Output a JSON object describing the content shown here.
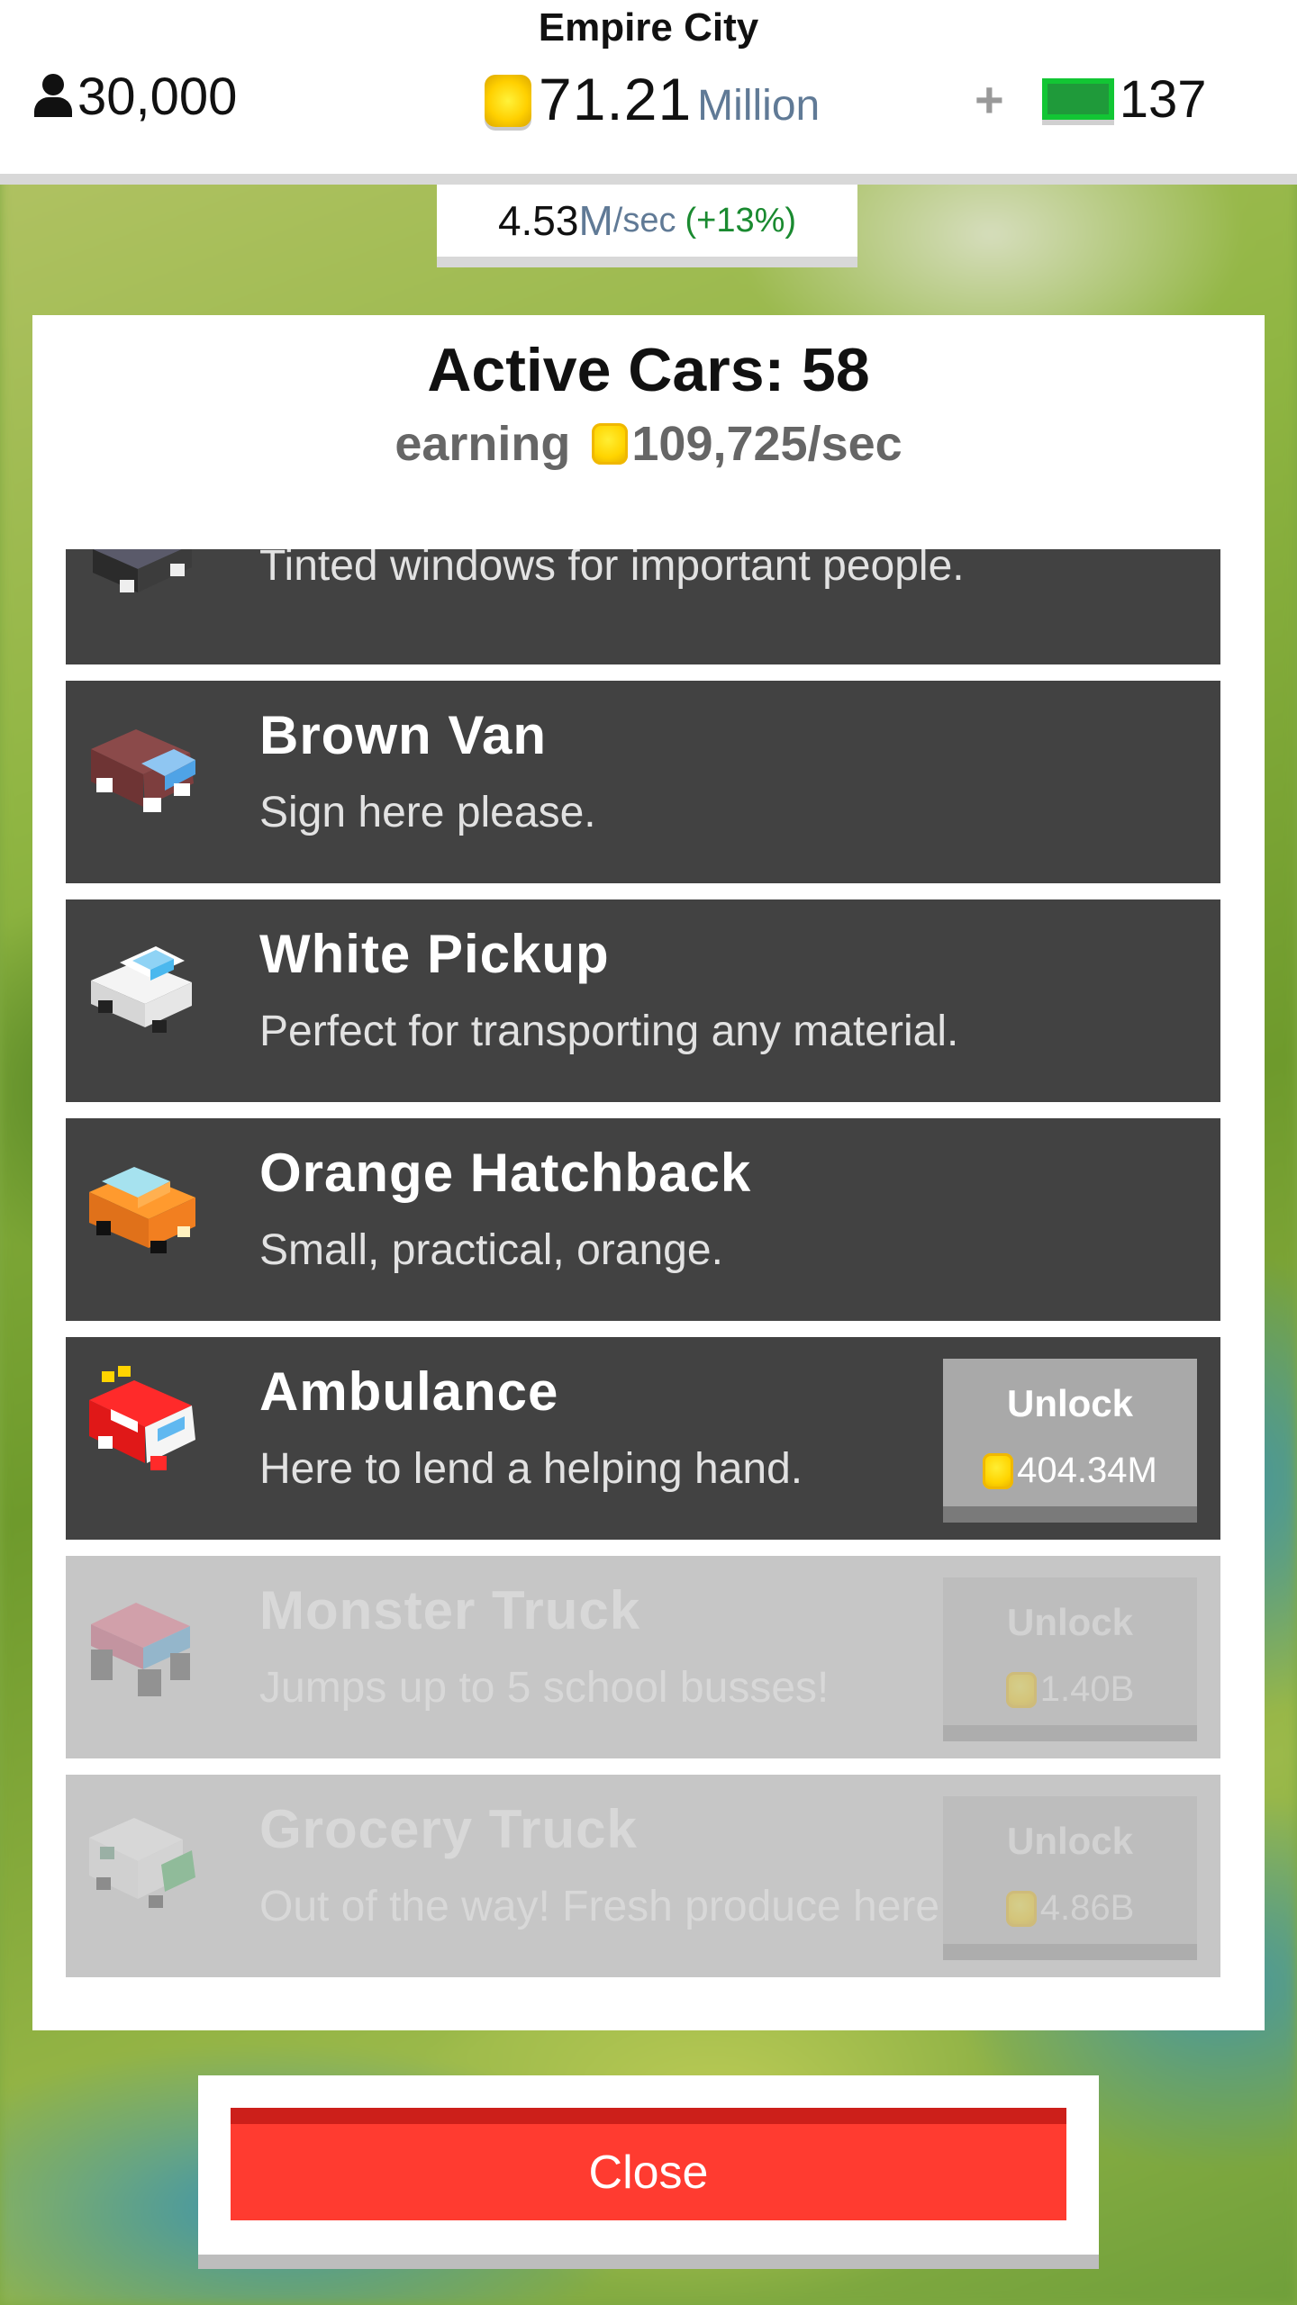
{
  "hud": {
    "city_name": "Empire City",
    "population": "30,000",
    "money_value": "71.21",
    "money_unit": "Million",
    "cash_value": "137",
    "rate_value": "4.53",
    "rate_unit": "M",
    "rate_unit_sec": "/sec",
    "rate_bonus": "(+13%)"
  },
  "modal": {
    "title": "Active Cars: 58",
    "earning_label": "earning",
    "earning_value": "109,725/sec",
    "cars": [
      {
        "name": "",
        "description": "Tinted windows for important people.",
        "state": "unlocked",
        "icon": "black-limo-icon"
      },
      {
        "name": "Brown Van",
        "description": "Sign here please.",
        "state": "unlocked",
        "icon": "brown-van-icon"
      },
      {
        "name": "White Pickup",
        "description": "Perfect for transporting any material.",
        "state": "unlocked",
        "icon": "white-pickup-icon"
      },
      {
        "name": "Orange Hatchback",
        "description": "Small, practical, orange.",
        "state": "unlocked",
        "icon": "orange-hatchback-icon"
      },
      {
        "name": "Ambulance",
        "description": "Here to lend a helping hand.",
        "state": "available",
        "icon": "ambulance-icon",
        "unlock_label": "Unlock",
        "price": "404.34M"
      },
      {
        "name": "Monster Truck",
        "description": "Jumps up to 5 school busses!",
        "state": "locked",
        "icon": "monster-truck-icon",
        "unlock_label": "Unlock",
        "price": "1.40B"
      },
      {
        "name": "Grocery Truck",
        "description": "Out of the way! Fresh produce here!",
        "state": "locked",
        "icon": "grocery-truck-icon",
        "unlock_label": "Unlock",
        "price": "4.86B"
      }
    ]
  },
  "close_label": "Close",
  "colors": {
    "row_dark": "#424242",
    "row_locked": "#c6c6c6",
    "close_red": "#ff3b30",
    "coin_yellow": "#ffd400",
    "cash_green": "#1f9a3a"
  }
}
